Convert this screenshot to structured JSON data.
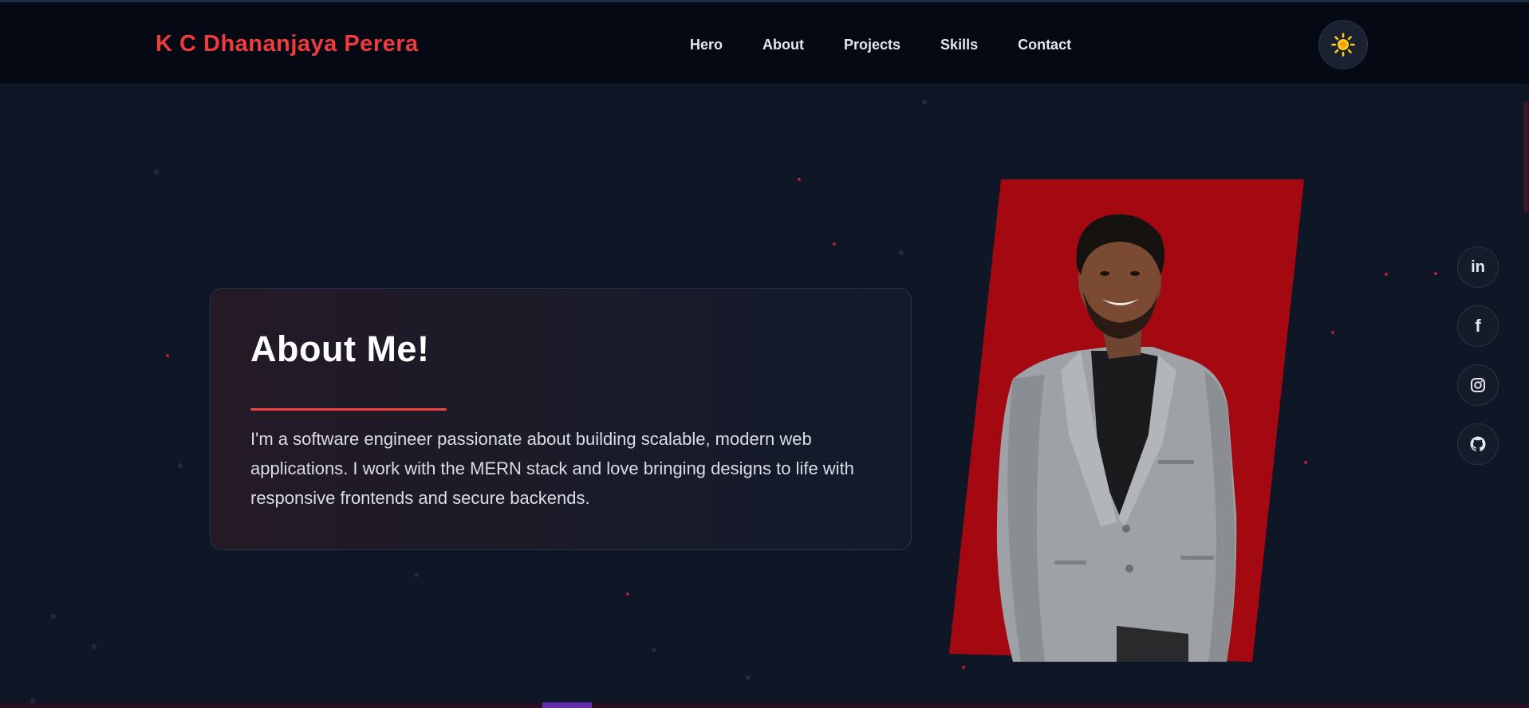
{
  "brand": {
    "name": "K C Dhananjaya Perera"
  },
  "nav": {
    "items": [
      "Hero",
      "About",
      "Projects",
      "Skills",
      "Contact"
    ]
  },
  "theme_toggle": {
    "icon": "sun-icon",
    "color": "#facc15"
  },
  "about": {
    "title": "About Me!",
    "text": "I'm a software engineer passionate about building scalable, modern web applications. I work with the MERN stack and love bringing designs to life with responsive frontends and secure backends."
  },
  "social": [
    {
      "name": "linkedin",
      "icon": "linkedin-icon",
      "label": "in"
    },
    {
      "name": "facebook",
      "icon": "facebook-icon",
      "label": "f"
    },
    {
      "name": "instagram",
      "icon": "instagram-icon"
    },
    {
      "name": "github",
      "icon": "github-icon"
    }
  ],
  "colors": {
    "accent": "#ef4444",
    "background": "#0f1727",
    "navbar": "#050914",
    "photo_panel": "#a40912"
  }
}
